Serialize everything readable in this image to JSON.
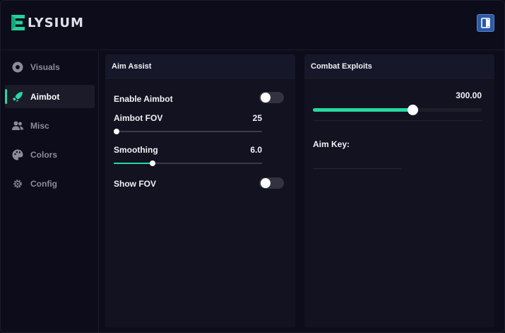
{
  "app": {
    "logo_text": "LYSIUM"
  },
  "sidebar": {
    "items": [
      {
        "label": "Visuals",
        "icon": "eye-icon",
        "active": false
      },
      {
        "label": "Aimbot",
        "icon": "rocket-icon",
        "active": true
      },
      {
        "label": "Misc",
        "icon": "users-icon",
        "active": false
      },
      {
        "label": "Colors",
        "icon": "palette-icon",
        "active": false
      },
      {
        "label": "Config",
        "icon": "gear-icon",
        "active": false
      }
    ]
  },
  "aim_assist": {
    "title": "Aim Assist",
    "enable_aimbot": {
      "label": "Enable Aimbot",
      "on": false
    },
    "aimbot_fov": {
      "label": "Aimbot FOV",
      "value": "25",
      "fraction": 0.0
    },
    "smoothing": {
      "label": "Smoothing",
      "value": "6.0",
      "fraction": 0.26
    },
    "show_fov": {
      "label": "Show FOV",
      "on": false
    }
  },
  "combat_exploits": {
    "title": "Combat Exploits",
    "slider": {
      "value": "300.00",
      "fraction": 0.59
    },
    "aim_key": {
      "label": "Aim Key:",
      "value": ""
    }
  },
  "colors": {
    "accent": "#27d9a0",
    "exit_button": "#2a5aa8"
  }
}
